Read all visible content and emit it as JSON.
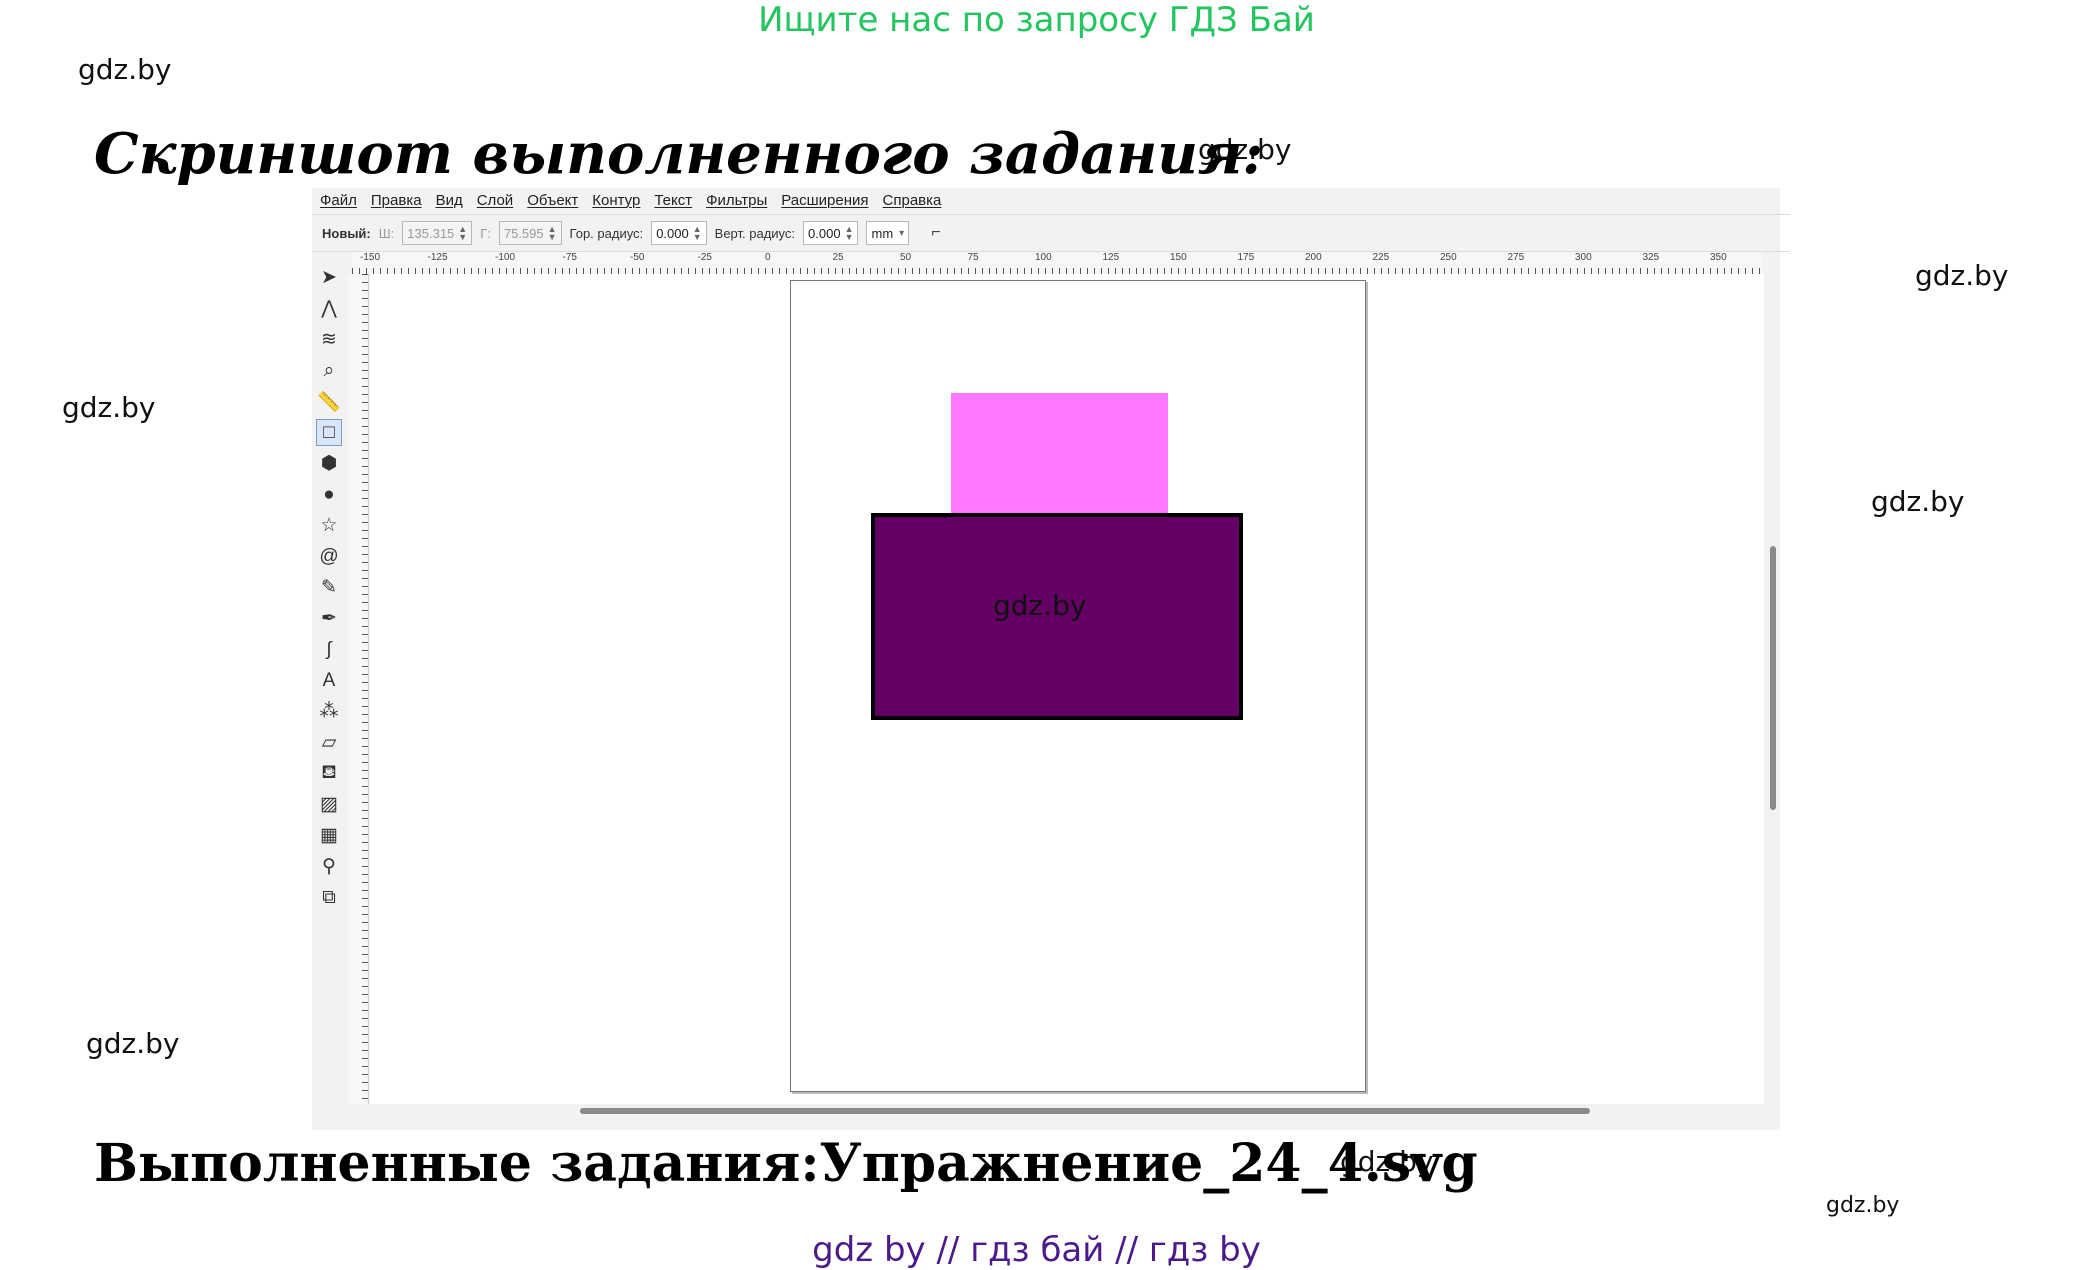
{
  "header": {
    "search_text": "Ищите нас по запросу ГДЗ Бай"
  },
  "watermark": "gdz.by",
  "document": {
    "title": "Скриншот выполненного задания:",
    "caption": "Выполненные задания:Упражнение_24_4.svg"
  },
  "footer": {
    "links": "gdz by  //  гдз бай  //  гдз by"
  },
  "app": {
    "menu": [
      "Файл",
      "Правка",
      "Вид",
      "Слой",
      "Объект",
      "Контур",
      "Текст",
      "Фильтры",
      "Расширения",
      "Справка"
    ],
    "toolbar": {
      "new_label": "Новый:",
      "width_label": "Ш:",
      "width_value": "135.315",
      "height_label": "Г:",
      "height_value": "75.595",
      "rx_label": "Гор. радиус:",
      "rx_value": "0.000",
      "ry_label": "Верт. радиус:",
      "ry_value": "0.000",
      "unit": "mm"
    },
    "ruler_ticks": [
      "-150",
      "-125",
      "-100",
      "-75",
      "-50",
      "-25",
      "0",
      "25",
      "50",
      "75",
      "100",
      "125",
      "150",
      "175",
      "200",
      "225",
      "250",
      "275",
      "300",
      "325",
      "350"
    ],
    "tools": [
      {
        "name": "select-tool-icon",
        "glyph": "➤"
      },
      {
        "name": "node-tool-icon",
        "glyph": "⋀"
      },
      {
        "name": "tweak-tool-icon",
        "glyph": "≋"
      },
      {
        "name": "zoom-tool-icon",
        "glyph": "⌕"
      },
      {
        "name": "measure-tool-icon",
        "glyph": "📏"
      },
      {
        "name": "rectangle-tool-icon",
        "glyph": "□"
      },
      {
        "name": "box3d-tool-icon",
        "glyph": "⬢"
      },
      {
        "name": "ellipse-tool-icon",
        "glyph": "●"
      },
      {
        "name": "star-tool-icon",
        "glyph": "☆"
      },
      {
        "name": "spiral-tool-icon",
        "glyph": "@"
      },
      {
        "name": "pencil-tool-icon",
        "glyph": "✎"
      },
      {
        "name": "pen-tool-icon",
        "glyph": "✒"
      },
      {
        "name": "calligraphy-tool-icon",
        "glyph": "∫"
      },
      {
        "name": "text-tool-icon",
        "glyph": "A"
      },
      {
        "name": "spray-tool-icon",
        "glyph": "⁂"
      },
      {
        "name": "eraser-tool-icon",
        "glyph": "▱"
      },
      {
        "name": "bucket-tool-icon",
        "glyph": "⛾"
      },
      {
        "name": "gradient-tool-icon",
        "glyph": "▨"
      },
      {
        "name": "mesh-tool-icon",
        "glyph": "▦"
      },
      {
        "name": "dropper-tool-icon",
        "glyph": "⚲"
      },
      {
        "name": "connector-tool-icon",
        "glyph": "⧉"
      }
    ],
    "shapes": {
      "pink_rect_color": "#ff77ff",
      "purple_rect_color": "#640064",
      "purple_rect_stroke": "#000000"
    }
  }
}
